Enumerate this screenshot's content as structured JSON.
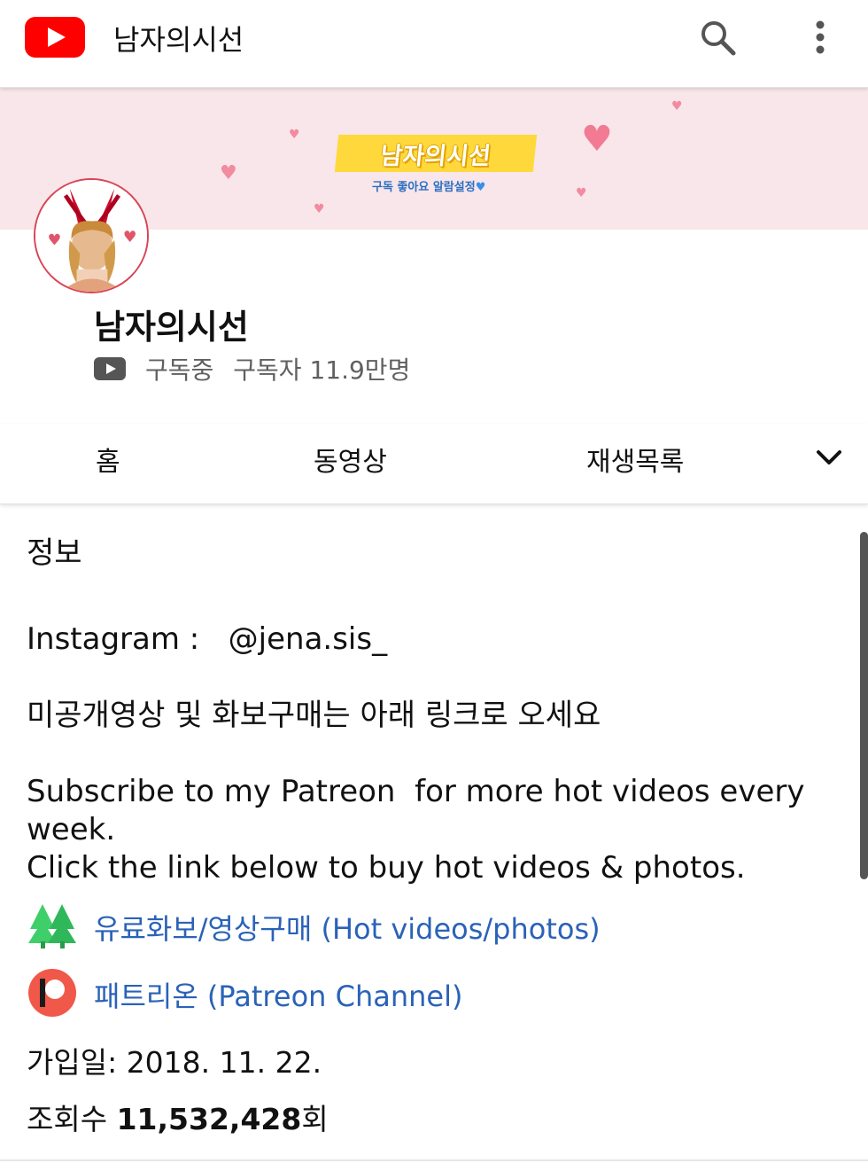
{
  "app": {
    "title": "남자의시선"
  },
  "banner": {
    "title": "남자의시선",
    "subtitle": "구독 좋아요 알람설정"
  },
  "channel": {
    "name": "남자의시선",
    "subscribed_label": "구독중",
    "subscriber_count": "구독자 11.9만명"
  },
  "tabs": [
    {
      "label": "홈"
    },
    {
      "label": "동영상"
    },
    {
      "label": "재생목록"
    }
  ],
  "about": {
    "title": "정보",
    "description": "Instagram :   @jena.sis_\n\n미공개영상 및 화보구매는 아래 링크로 오세요\n\nSubscribe to my Patreon  for more hot videos every week.\nClick the link below to buy hot videos & photos.",
    "links": [
      {
        "label": "유료화보/영상구매 (Hot videos/photos)",
        "icon": "green-trees-icon"
      },
      {
        "label": "패트리온 (Patreon Channel)",
        "icon": "patreon-icon"
      }
    ],
    "joined": "가입일: 2018. 11. 22.",
    "views_prefix": "조회수 ",
    "views_value": "11,532,428",
    "views_suffix": "회"
  },
  "colors": {
    "brand_red": "#ff0000",
    "link_blue": "#2a62b8",
    "banner_pink": "#f8e6ea"
  }
}
